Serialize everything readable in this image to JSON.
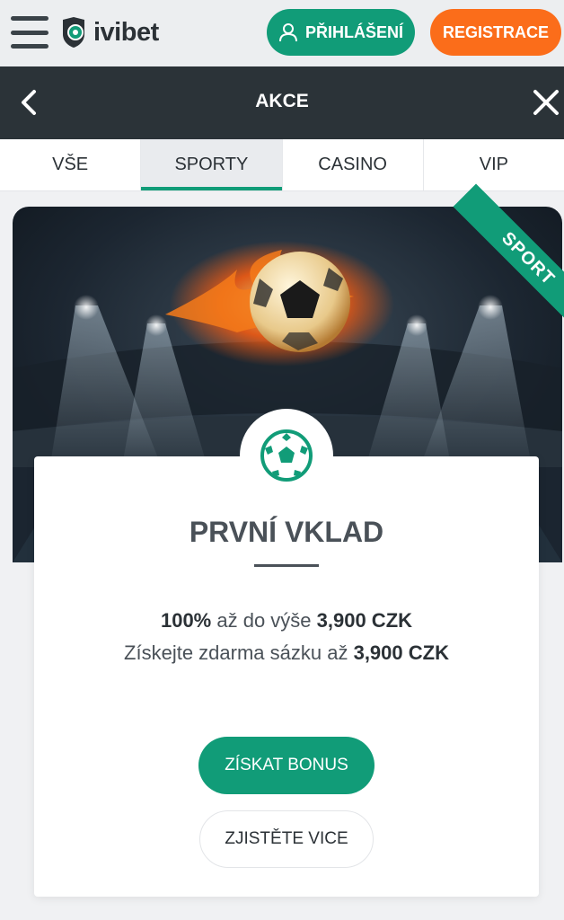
{
  "header": {
    "logo_text": "ivibet",
    "login_label": "PŘIHLÁŠENÍ",
    "register_label": "REGISTRACE",
    "menu_icon": "hamburger-menu-icon",
    "login_icon": "user-icon",
    "colors": {
      "green": "#119c78",
      "orange": "#fb6d1a",
      "dark": "#2b3338"
    }
  },
  "subheader": {
    "title": "AKCE",
    "back_icon": "chevron-left-icon",
    "close_icon": "close-icon"
  },
  "tabs": [
    {
      "label": "VŠE",
      "active": false
    },
    {
      "label": "SPORTY",
      "active": true
    },
    {
      "label": "CASINO",
      "active": false
    },
    {
      "label": "VIP",
      "active": false
    }
  ],
  "promo": {
    "ribbon": "SPORT",
    "badge_icon": "soccer-ball-icon",
    "title": "PRVNÍ VKLAD",
    "line1_strong": "100%",
    "line1_text": " až do výše ",
    "line1_amount": "3,900 CZK",
    "line2_text": "Získejte zdarma sázku až ",
    "line2_amount": "3,900 CZK",
    "primary_button": "ZÍSKAT BONUS",
    "secondary_button": "ZJISTĚTE VICE"
  }
}
